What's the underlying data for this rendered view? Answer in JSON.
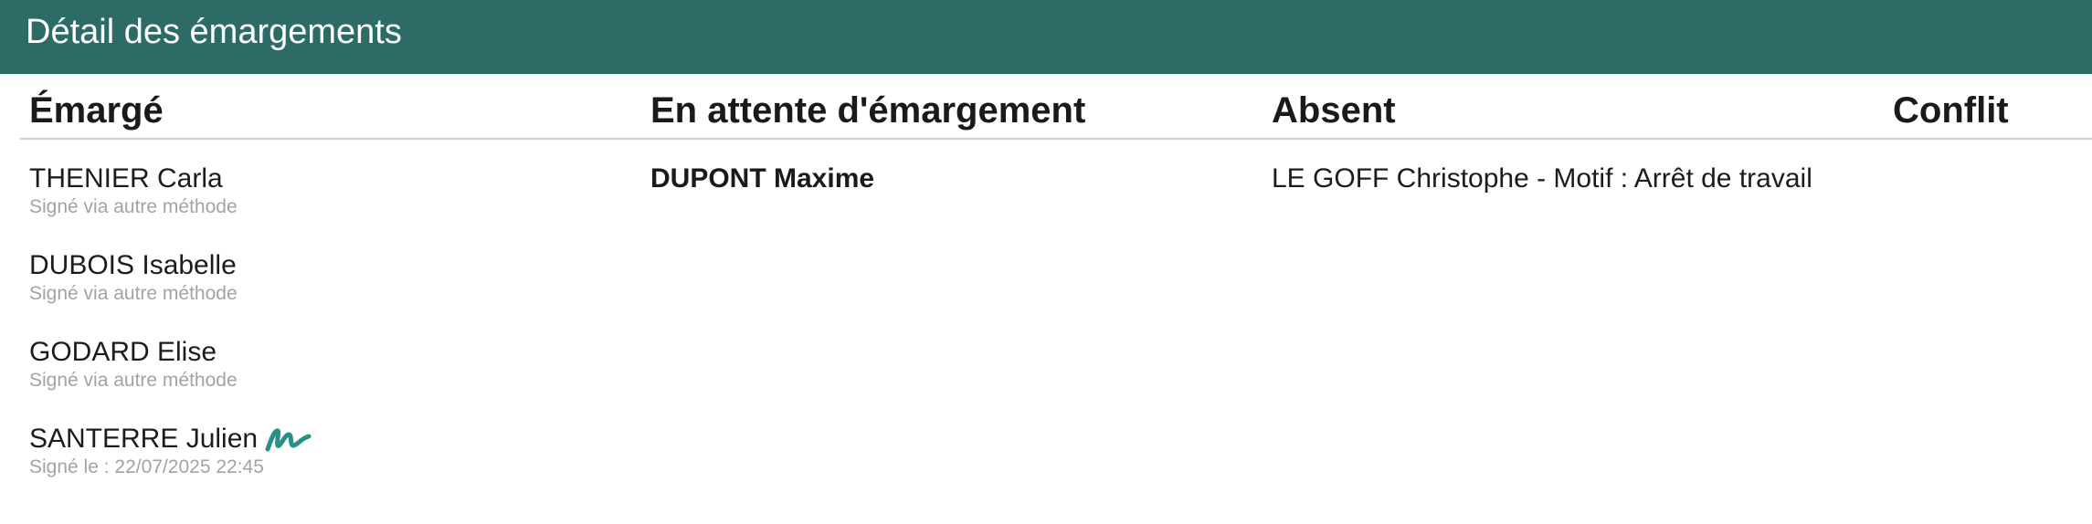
{
  "header": {
    "title": "Détail des émargements"
  },
  "columns": {
    "signed": "Émargé",
    "pending": "En attente d'émargement",
    "absent": "Absent",
    "conflict": "Conflit"
  },
  "signed": [
    {
      "name": "THENIER Carla",
      "detail": "Signé via autre méthode"
    },
    {
      "name": "DUBOIS Isabelle",
      "detail": "Signé via autre méthode"
    },
    {
      "name": "GODARD Elise",
      "detail": "Signé via autre méthode"
    },
    {
      "name": "SANTERRE Julien",
      "detail": "Signé le : 22/07/2025 22:45",
      "icon": "signature-icon"
    }
  ],
  "pending": [
    {
      "name": "DUPONT Maxime"
    }
  ],
  "absent": [
    {
      "text": "LE GOFF Christophe - Motif : Arrêt de travail"
    }
  ],
  "conflict": [],
  "colors": {
    "header_bg": "#2c6b66",
    "signature": "#2a8f85",
    "muted_text": "#a3a3a3"
  }
}
